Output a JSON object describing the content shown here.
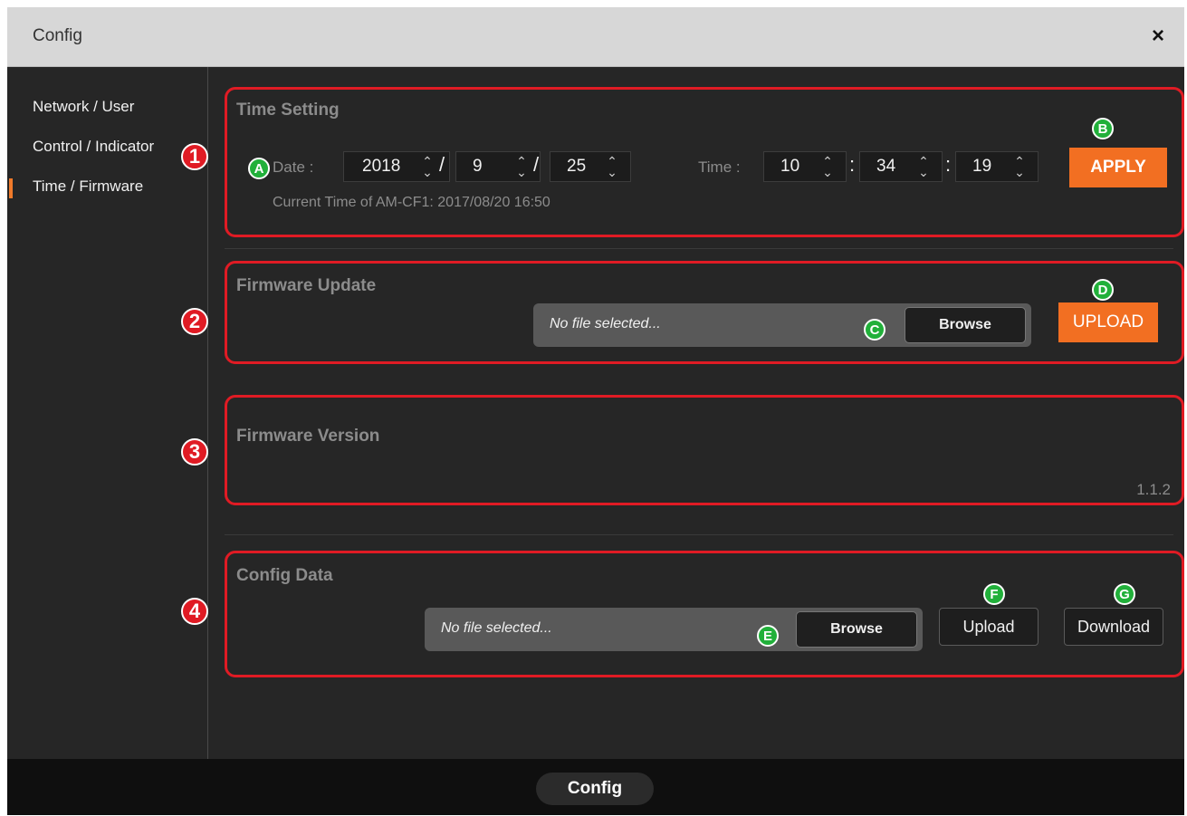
{
  "window": {
    "title": "Config",
    "close_glyph": "×"
  },
  "sidebar": {
    "items": [
      {
        "label": "Network / User"
      },
      {
        "label": "Control / Indicator"
      },
      {
        "label": "Time / Firmware",
        "active": true
      }
    ],
    "accent_color": "#f07a2a"
  },
  "time_setting": {
    "title": "Time Setting",
    "date_label": "Date :",
    "date": {
      "year": "2018",
      "month": "9",
      "day": "25"
    },
    "date_sep": "/",
    "time_label": "Time :",
    "time": {
      "hour": "10",
      "minute": "34",
      "second": "19"
    },
    "time_sep": ":",
    "current_time": "Current Time of AM-CF1: 2017/08/20 16:50",
    "apply_label": "APPLY"
  },
  "firmware_update": {
    "title": "Firmware Update",
    "file_placeholder": "No file selected...",
    "browse_label": "Browse",
    "upload_label": "UPLOAD"
  },
  "firmware_version": {
    "title": "Firmware Version",
    "version": "1.1.2"
  },
  "config_data": {
    "title": "Config Data",
    "file_placeholder": "No file selected...",
    "browse_label": "Browse",
    "upload_label": "Upload",
    "download_label": "Download"
  },
  "callouts": {
    "red": [
      "1",
      "2",
      "3",
      "4"
    ],
    "green": [
      "A",
      "B",
      "C",
      "D",
      "E",
      "F",
      "G"
    ]
  },
  "bottom": {
    "label": "Config"
  },
  "colors": {
    "accent": "#f26f22",
    "highlight": "#e01b24",
    "callout_green": "#21b03a"
  }
}
